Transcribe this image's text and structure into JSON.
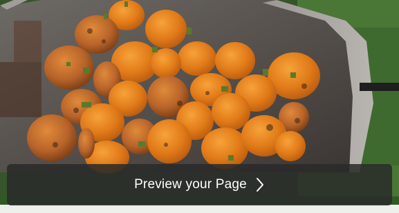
{
  "preview_button": {
    "label": "Preview your Page",
    "icon": "chevron-right-icon"
  },
  "photo": {
    "subject": "pumpkins-in-wheelbarrow-photo"
  },
  "colors": {
    "overlay": "#2a2a2a",
    "text": "#ffffff",
    "pumpkin": "#e8821e",
    "wheelbarrow": "#8a8784",
    "grass": "#3f6b2e"
  }
}
